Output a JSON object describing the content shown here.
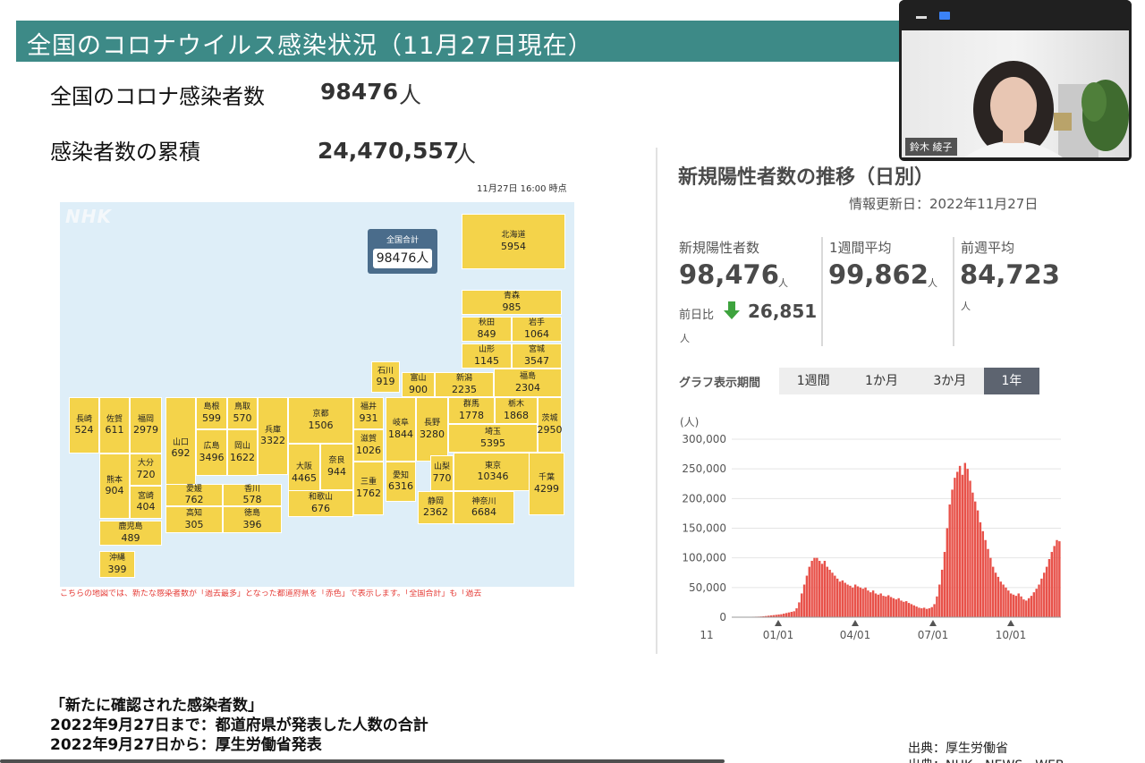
{
  "slide": {
    "title": "全国のコロナウイルス感染状況（11月27日現在）",
    "stat1_label": "全国のコロナ感染者数",
    "stat1_value": "98476",
    "stat1_unit": "人",
    "stat2_label": "感染者数の累積",
    "stat2_value": "24,470,557",
    "stat2_unit": "人"
  },
  "map": {
    "timestamp": "11月27日 16:00 時点",
    "logo": "NHK",
    "total_label": "全国合計",
    "total_value": "98476人",
    "note": "こちらの地図では、新たな感染者数が「過去最多」となった都道府県を「赤色」で表示します。「全国合計」も「過去",
    "prefectures": [
      {
        "name": "北海道",
        "value": "5954"
      },
      {
        "name": "青森",
        "value": "985"
      },
      {
        "name": "秋田",
        "value": "849"
      },
      {
        "name": "岩手",
        "value": "1064"
      },
      {
        "name": "山形",
        "value": "1145"
      },
      {
        "name": "宮城",
        "value": "3547"
      },
      {
        "name": "石川",
        "value": "919"
      },
      {
        "name": "富山",
        "value": "900"
      },
      {
        "name": "新潟",
        "value": "2235"
      },
      {
        "name": "福島",
        "value": "2304"
      },
      {
        "name": "長崎",
        "value": "524"
      },
      {
        "name": "佐賀",
        "value": "611"
      },
      {
        "name": "福岡",
        "value": "2979"
      },
      {
        "name": "山口",
        "value": "692"
      },
      {
        "name": "島根",
        "value": "599"
      },
      {
        "name": "鳥取",
        "value": "570"
      },
      {
        "name": "兵庫",
        "value": "3322"
      },
      {
        "name": "京都",
        "value": "1506"
      },
      {
        "name": "福井",
        "value": "931"
      },
      {
        "name": "岐阜",
        "value": "1844"
      },
      {
        "name": "長野",
        "value": "3280"
      },
      {
        "name": "群馬",
        "value": "1778"
      },
      {
        "name": "栃木",
        "value": "1868"
      },
      {
        "name": "広島",
        "value": "3496"
      },
      {
        "name": "岡山",
        "value": "1622"
      },
      {
        "name": "大阪",
        "value": "4465"
      },
      {
        "name": "滋賀",
        "value": "1026"
      },
      {
        "name": "埼玉",
        "value": "5395"
      },
      {
        "name": "茨城",
        "value": "2950"
      },
      {
        "name": "熊本",
        "value": "904"
      },
      {
        "name": "大分",
        "value": "720"
      },
      {
        "name": "奈良",
        "value": "944"
      },
      {
        "name": "三重",
        "value": "1762"
      },
      {
        "name": "愛知",
        "value": "6316"
      },
      {
        "name": "山梨",
        "value": "770"
      },
      {
        "name": "東京",
        "value": "10346"
      },
      {
        "name": "千葉",
        "value": "4299"
      },
      {
        "name": "宮崎",
        "value": "404"
      },
      {
        "name": "愛媛",
        "value": "762"
      },
      {
        "name": "香川",
        "value": "578"
      },
      {
        "name": "和歌山",
        "value": "676"
      },
      {
        "name": "高知",
        "value": "305"
      },
      {
        "name": "徳島",
        "value": "396"
      },
      {
        "name": "静岡",
        "value": "2362"
      },
      {
        "name": "神奈川",
        "value": "6684"
      },
      {
        "name": "鹿児島",
        "value": "489"
      },
      {
        "name": "沖縄",
        "value": "399"
      }
    ]
  },
  "panel": {
    "title": "新規陽性者数の推移（日別）",
    "updated": "情報更新日：2022年11月27日",
    "kpi": [
      {
        "label": "新規陽性者数",
        "value": "98,476",
        "unit": "人"
      },
      {
        "label": "1週間平均",
        "value": "99,862",
        "unit": "人"
      },
      {
        "label": "前週平均",
        "value": "84,723",
        "unit": "人"
      }
    ],
    "diff_label": "前日比",
    "diff_value": "26,851",
    "diff_unit": "人",
    "period_label": "グラフ表示期間",
    "periods": [
      "1週間",
      "1か月",
      "3か月",
      "1年"
    ],
    "active_period": "1年"
  },
  "chart_data": {
    "type": "bar",
    "title": "",
    "ylabel": "(人)",
    "yticks": [
      "300,000",
      "250,000",
      "200,000",
      "150,000",
      "100,000",
      "50,000",
      "0"
    ],
    "xticks": [
      "11",
      "01/01",
      "04/01",
      "07/01",
      "10/01"
    ],
    "ylim": [
      0,
      300000
    ],
    "grid": true,
    "color": "#e8524a",
    "series": [
      {
        "values": [
          300,
          350,
          400,
          450,
          500,
          550,
          600,
          700,
          800,
          900,
          1000,
          1200,
          1500,
          2000,
          2500,
          3000,
          3500,
          4000,
          4500,
          5000,
          6000,
          7000,
          8000,
          9000,
          10000,
          15000,
          25000,
          40000,
          55000,
          70000,
          85000,
          95000,
          100000,
          100000,
          95000,
          90000,
          95000,
          85000,
          80000,
          75000,
          70000,
          65000,
          60000,
          62000,
          58000,
          55000,
          53000,
          50000,
          55000,
          52000,
          50000,
          48000,
          50000,
          45000,
          42000,
          45000,
          40000,
          38000,
          40000,
          36000,
          35000,
          37000,
          34000,
          32000,
          30000,
          32000,
          28000,
          26000,
          27000,
          24000,
          22000,
          20000,
          18000,
          16000,
          15000,
          16000,
          14000,
          15000,
          17000,
          22000,
          35000,
          55000,
          80000,
          110000,
          150000,
          190000,
          215000,
          235000,
          245000,
          255000,
          240000,
          260000,
          250000,
          230000,
          210000,
          195000,
          180000,
          160000,
          145000,
          130000,
          115000,
          100000,
          85000,
          75000,
          68000,
          60000,
          55000,
          50000,
          45000,
          40000,
          38000,
          36000,
          40000,
          35000,
          30000,
          28000,
          32000,
          36000,
          42000,
          48000,
          55000,
          65000,
          75000,
          85000,
          98000,
          110000,
          120000,
          130000,
          128000
        ]
      }
    ]
  },
  "bottom": {
    "line1": "「新たに確認された感染者数」",
    "line2": "2022年9月27日まで：都道府県が発表した人数の合計",
    "line3": "2022年9月27日から：厚生労働省発表",
    "source1": "出典：厚生労働省",
    "source2": "出典：NHK　NEWS　WEB"
  },
  "video": {
    "name": "鈴木 綾子"
  }
}
